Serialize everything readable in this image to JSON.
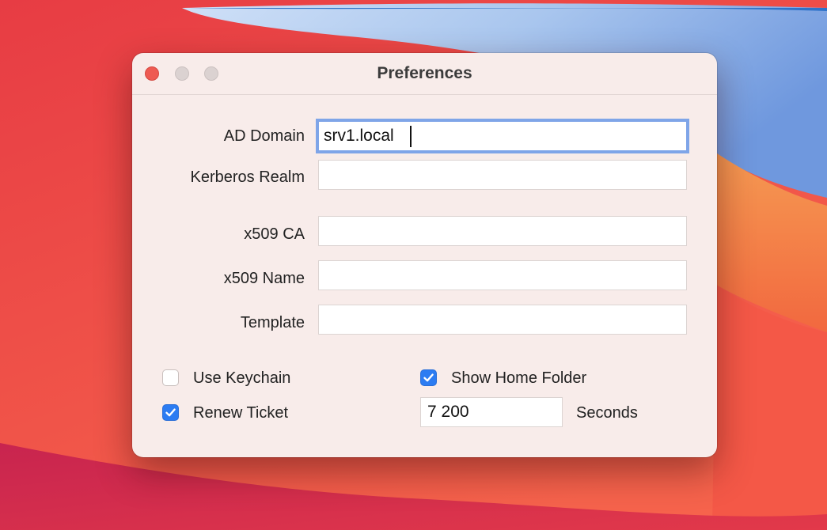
{
  "window": {
    "title": "Preferences"
  },
  "fields": [
    {
      "label": "AD Domain",
      "value": "srv1.local",
      "focused": true
    },
    {
      "label": "Kerberos Realm",
      "value": ""
    },
    {
      "label": "x509 CA",
      "value": ""
    },
    {
      "label": "x509 Name",
      "value": ""
    },
    {
      "label": "Template",
      "value": ""
    }
  ],
  "options": {
    "use_keychain": {
      "label": "Use Keychain",
      "checked": false
    },
    "renew_ticket": {
      "label": "Renew Ticket",
      "checked": true
    },
    "show_home_folder": {
      "label": "Show Home Folder",
      "checked": true
    },
    "renew_interval": {
      "value": "7 200",
      "unit_label": "Seconds"
    }
  },
  "colors": {
    "accent": "#2c7cf2",
    "focus_ring": "#7fa5e8",
    "close_button": "#ee5a52",
    "window_bg": "#f8ecea"
  }
}
